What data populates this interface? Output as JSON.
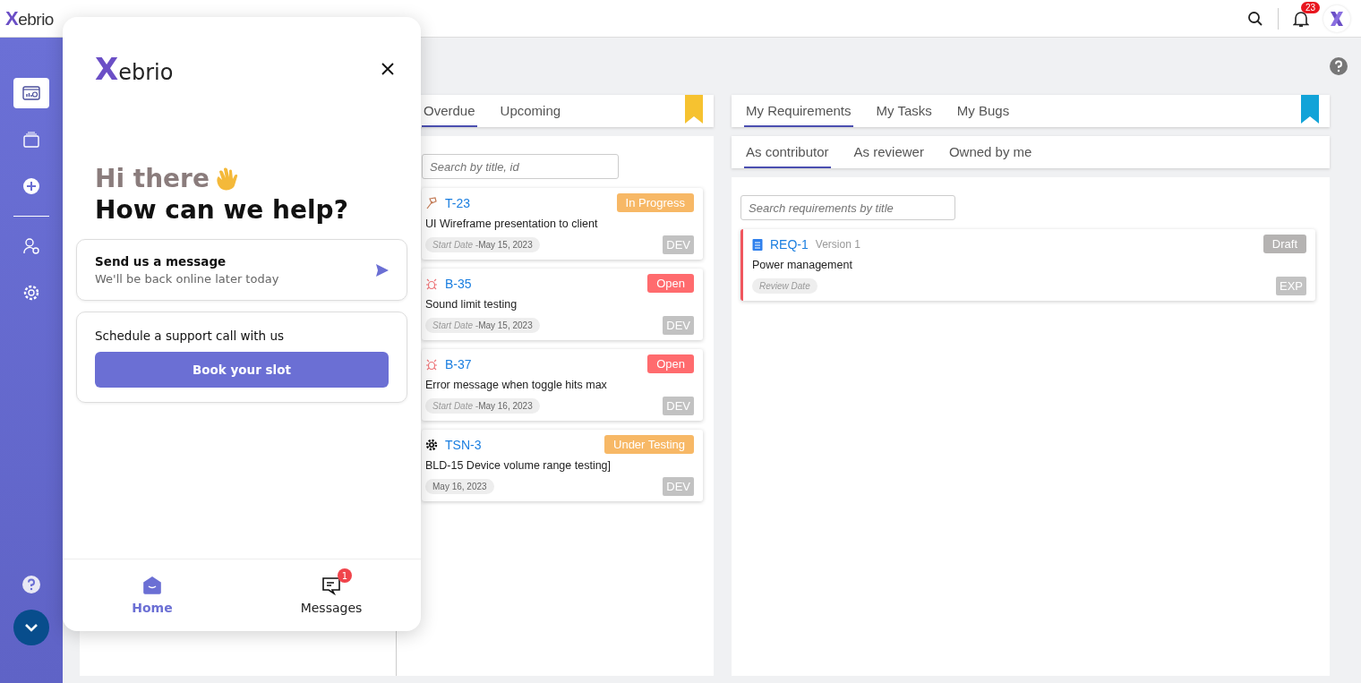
{
  "topbar": {
    "logo": "Xebrio",
    "notification_count": "23"
  },
  "sidebar": {
    "items": [
      {
        "selected": true
      },
      {
        "selected": false
      },
      {
        "selected": false
      },
      {
        "selected": false
      },
      {
        "selected": false
      }
    ]
  },
  "chat_popup": {
    "logo": "Xebrio",
    "greeting": "Hi there",
    "heading": "How can we help?",
    "message_card": {
      "title": "Send us a message",
      "subtitle": "We'll be back online later today"
    },
    "schedule_card": {
      "title": "Schedule a support call with us",
      "button": "Book your slot"
    },
    "nav": [
      {
        "label": "Home",
        "selected": true
      },
      {
        "label": "Messages",
        "selected": false,
        "badge": "1"
      }
    ]
  },
  "work_panel": {
    "tabs": [
      {
        "label": "Overdue",
        "selected": true
      },
      {
        "label": "Upcoming",
        "selected": false
      }
    ],
    "search": {
      "placeholder": "Search by title, id"
    },
    "cards": [
      {
        "kind": "task",
        "id": "T-23",
        "status": "In Progress",
        "color": "#f7b866",
        "title": "UI Wireframe presentation to client",
        "date_label": "Start Date -",
        "date": "May 15, 2023",
        "team": "DEV"
      },
      {
        "kind": "bug",
        "id": "B-35",
        "status": "Open",
        "color": "#ff6b6e",
        "title": "Sound limit testing",
        "date_label": "Start Date -",
        "date": "May 15, 2023",
        "team": "DEV"
      },
      {
        "kind": "bug",
        "id": "B-37",
        "status": "Open",
        "color": "#ff6b6e",
        "title": "Error message when toggle hits max",
        "date_label": "Start Date -",
        "date": "May 16, 2023",
        "team": "DEV"
      },
      {
        "kind": "test",
        "id": "TSN-3",
        "status": "Under Testing",
        "color": "#f7b866",
        "title": "BLD-15 Device volume range testing]",
        "date": "May 16, 2023",
        "team": "DEV"
      }
    ]
  },
  "requirements_panel": {
    "tabs": [
      {
        "label": "My Requirements",
        "selected": true
      },
      {
        "label": "My Tasks",
        "selected": false
      },
      {
        "label": "My Bugs",
        "selected": false
      }
    ],
    "subtabs": [
      {
        "label": "As contributor",
        "selected": true
      },
      {
        "label": "As reviewer",
        "selected": false
      },
      {
        "label": "Owned by me",
        "selected": false
      }
    ],
    "search": {
      "placeholder": "Search requirements by title"
    },
    "cards": [
      {
        "id": "REQ-1",
        "version": "Version 1",
        "status": "Draft",
        "title": "Power management",
        "date_label": "Review Date",
        "tag": "EXP"
      }
    ]
  }
}
